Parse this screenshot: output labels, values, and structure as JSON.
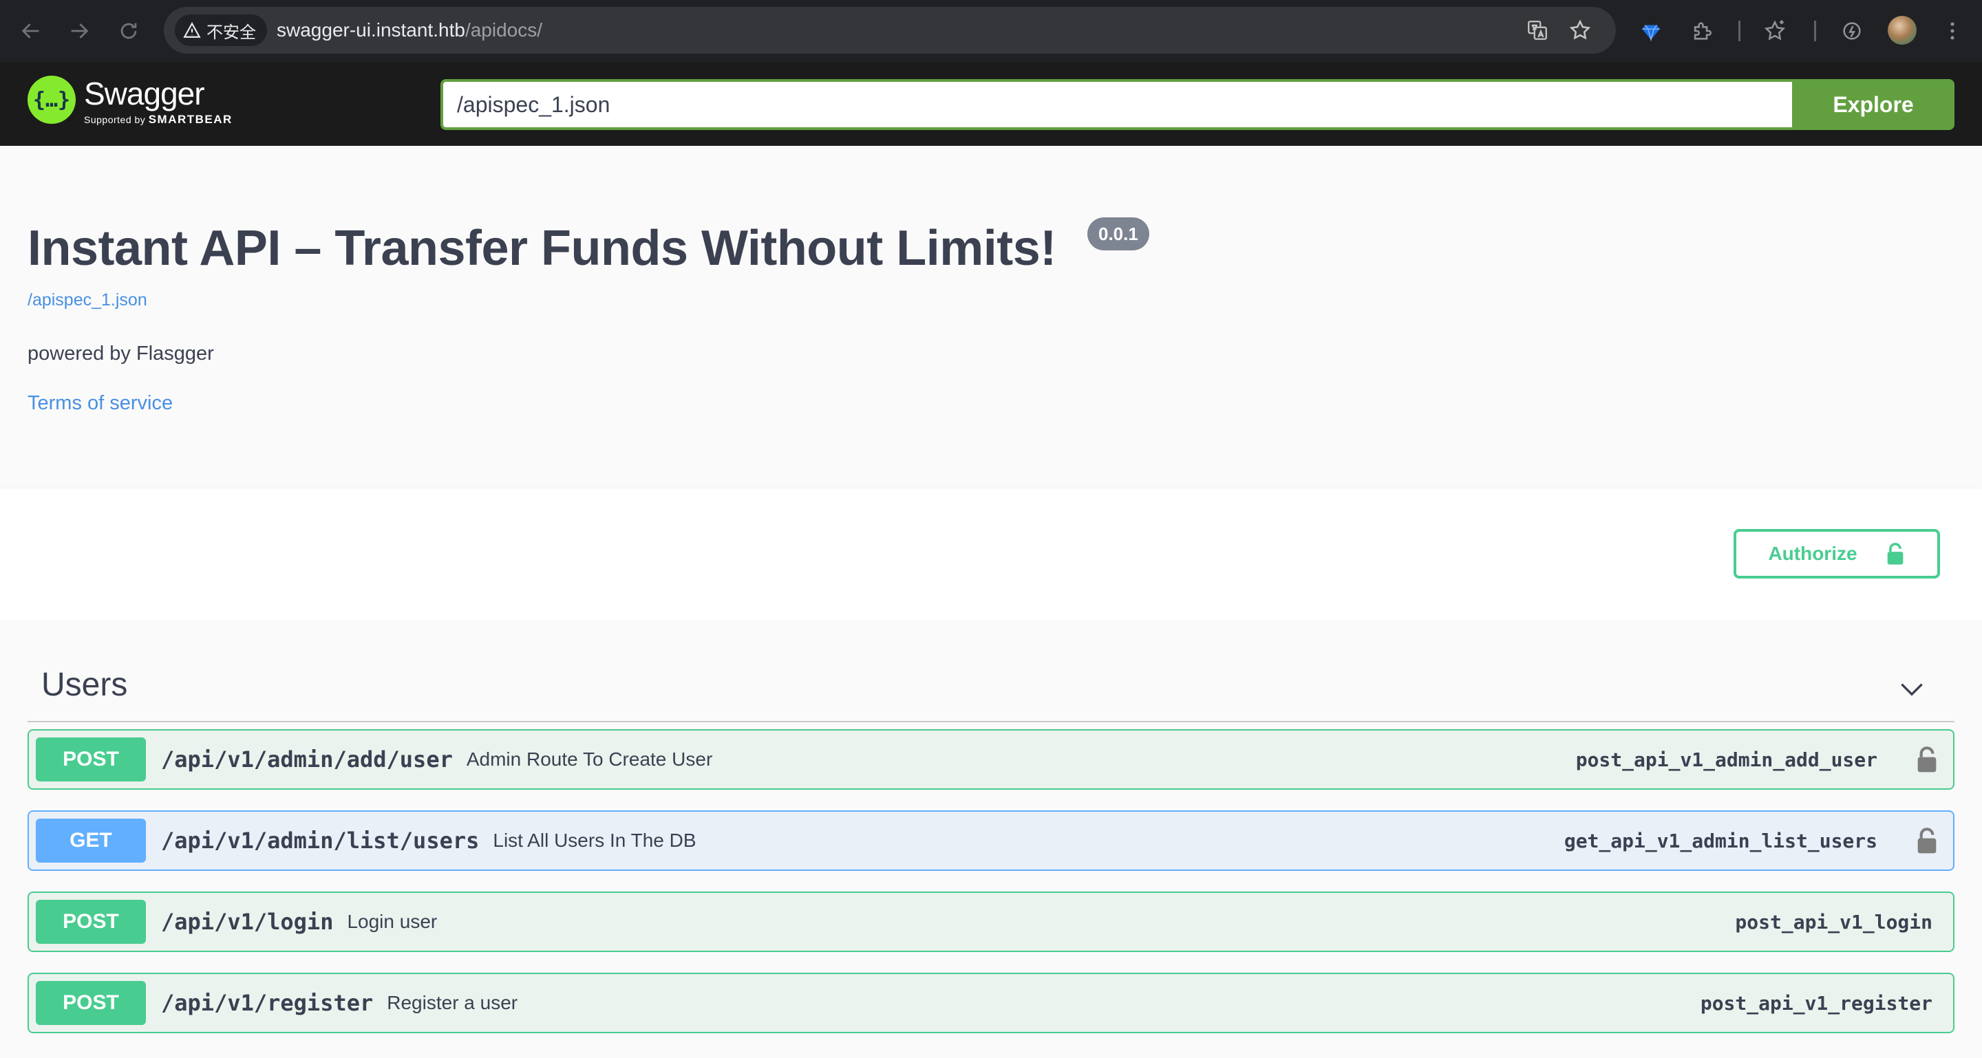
{
  "browser": {
    "security_label": "不安全",
    "url_host": "swagger-ui.instant.htb",
    "url_path": "/apidocs/"
  },
  "topbar": {
    "logo_name": "Swagger",
    "logo_supported": "Supported by",
    "logo_brand": "SMARTBEAR",
    "spec_url_value": "/apispec_1.json",
    "explore_label": "Explore"
  },
  "info": {
    "title": "Instant API – Transfer Funds Without Limits!",
    "version": "0.0.1",
    "spec_link": "/apispec_1.json",
    "description": "powered by Flasgger",
    "terms_label": "Terms of service"
  },
  "scheme": {
    "authorize_label": "Authorize"
  },
  "tag": {
    "name": "Users",
    "operations": [
      {
        "method": "POST",
        "path": "/api/v1/admin/add/user",
        "summary": "Admin Route To Create User",
        "operation_id": "post_api_v1_admin_add_user",
        "locked": true
      },
      {
        "method": "GET",
        "path": "/api/v1/admin/list/users",
        "summary": "List All Users In The DB",
        "operation_id": "get_api_v1_admin_list_users",
        "locked": true
      },
      {
        "method": "POST",
        "path": "/api/v1/login",
        "summary": "Login user",
        "operation_id": "post_api_v1_login",
        "locked": false
      },
      {
        "method": "POST",
        "path": "/api/v1/register",
        "summary": "Register a user",
        "operation_id": "post_api_v1_register",
        "locked": false
      }
    ]
  },
  "colors": {
    "post": "#49cc90",
    "get": "#61affe",
    "swagger_green": "#62a03f",
    "link": "#4990e2",
    "text": "#3b4151"
  }
}
